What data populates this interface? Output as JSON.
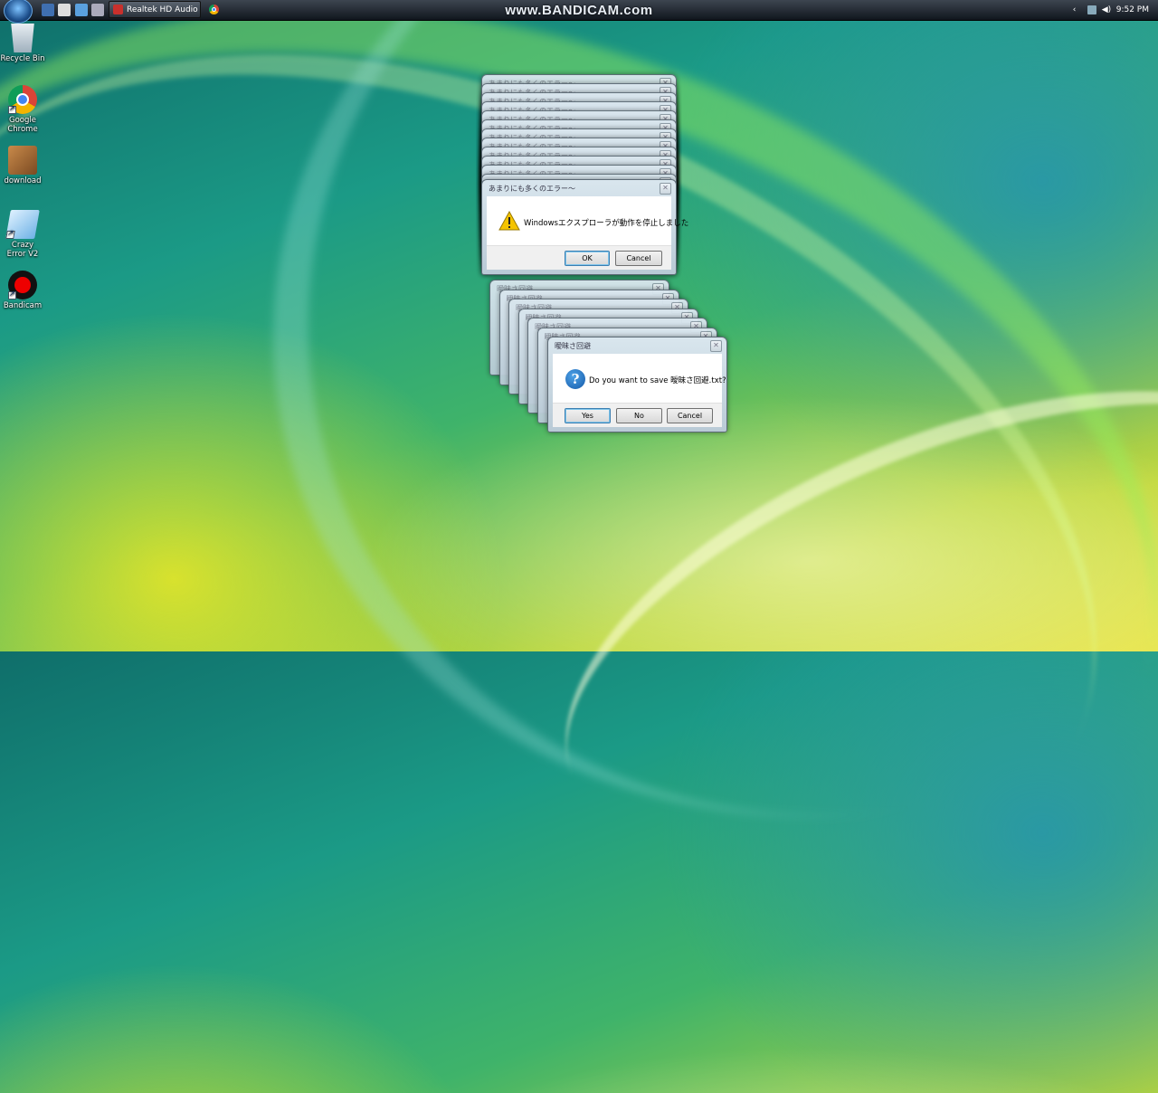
{
  "taskbar": {
    "task_button_label": "Realtek HD Audio M...",
    "clock": "9:52 PM"
  },
  "watermark": "www.BANDICAM.com",
  "desktop_icons": [
    {
      "label": "Recycle Bin",
      "icon": "recycle-bin-icon"
    },
    {
      "label": "Google Chrome",
      "icon": "chrome-icon"
    },
    {
      "label": "download",
      "icon": "image-file-icon"
    },
    {
      "label": "Crazy Error V2",
      "icon": "app-icon"
    },
    {
      "label": "Bandicam",
      "icon": "bandicam-icon"
    }
  ],
  "error_dialog": {
    "title": "あまりにも多くのエラー〜",
    "message": "Windowsエクスプローラが動作を停止しました",
    "ok": "OK",
    "cancel": "Cancel"
  },
  "save_dialog": {
    "title": "曖昧さ回避",
    "message": "Do you want to save 曖昧さ回避.txt?",
    "yes": "Yes",
    "no": "No",
    "cancel": "Cancel"
  },
  "colors": {
    "default_button_border": "#3c7fb1",
    "question_icon": "#1459a8",
    "warning_icon": "#f5c400"
  }
}
